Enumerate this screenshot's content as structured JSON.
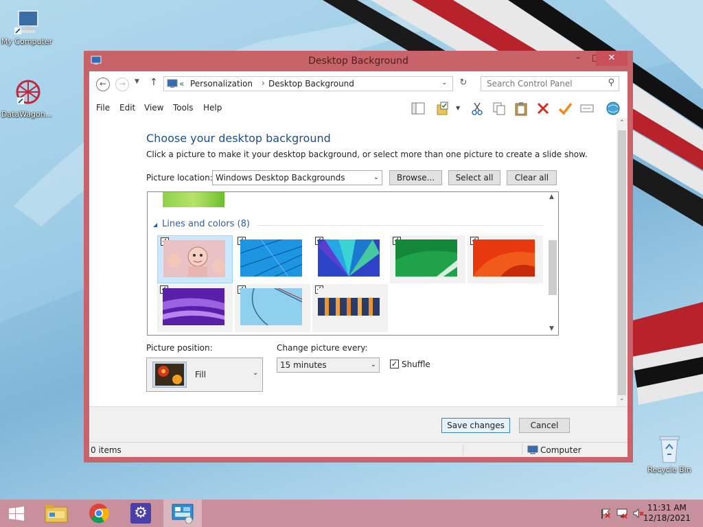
{
  "desktop_icons": [
    {
      "label": "My Computer"
    },
    {
      "label": "DataWagon..."
    },
    {
      "label": "Recycle Bin"
    }
  ],
  "window": {
    "title": "Desktop Background",
    "min": "–",
    "max": "□",
    "close": "✕"
  },
  "address": {
    "chevrons": "«",
    "crumb1": "Personalization",
    "sep": "›",
    "crumb2": "Desktop Background",
    "search_placeholder": "Search Control Panel"
  },
  "menu": [
    "File",
    "Edit",
    "View",
    "Tools",
    "Help"
  ],
  "main": {
    "heading": "Choose your desktop background",
    "description": "Click a picture to make it your desktop background, or select more than one picture to create a slide show.",
    "picture_location_label": "Picture location:",
    "picture_location_value": "Windows Desktop Backgrounds",
    "browse": "Browse...",
    "select_all": "Select all",
    "clear_all": "Clear all",
    "group_label": "Lines and colors (8)",
    "picture_position_label": "Picture position:",
    "picture_position_value": "Fill",
    "change_every_label": "Change picture every:",
    "change_every_value": "15 minutes",
    "shuffle_label": "Shuffle",
    "shuffle_checked": true
  },
  "thumbnails": [
    {
      "name": "cartoon",
      "checked": true,
      "selected": true
    },
    {
      "name": "blue-lines",
      "checked": true
    },
    {
      "name": "blue-fan",
      "checked": true
    },
    {
      "name": "green",
      "checked": true
    },
    {
      "name": "red-orange",
      "checked": true
    },
    {
      "name": "purple-waves",
      "checked": true
    },
    {
      "name": "light-blue-curve",
      "checked": true
    },
    {
      "name": "orange-bars",
      "checked": true
    }
  ],
  "footer": {
    "save": "Save changes",
    "cancel": "Cancel"
  },
  "status": {
    "items": "0 items",
    "location": "Computer"
  },
  "clock": {
    "time": "11:31 AM",
    "date": "12/18/2021"
  },
  "colors": {
    "window_frame": "#c9636a",
    "taskbar": "#c7909c",
    "heading": "#1e4e8c"
  }
}
